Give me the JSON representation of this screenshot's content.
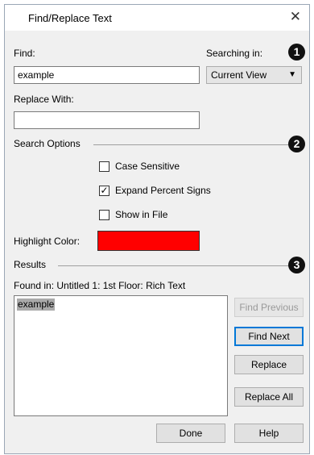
{
  "window": {
    "title": "Find/Replace Text",
    "close_glyph": "✕"
  },
  "find": {
    "label": "Find:",
    "value": "example"
  },
  "searching_in": {
    "label": "Searching in:",
    "value": "Current View",
    "arrow": "▼"
  },
  "replace": {
    "label": "Replace With:",
    "value": ""
  },
  "badges": {
    "one": "1",
    "two": "2",
    "three": "3"
  },
  "search_options": {
    "label": "Search Options",
    "case_sensitive": {
      "label": "Case Sensitive",
      "checked": false
    },
    "expand_percent": {
      "label": "Expand Percent Signs",
      "checked": true
    },
    "show_in_file": {
      "label": "Show in File",
      "checked": false
    }
  },
  "highlight": {
    "label": "Highlight Color:",
    "color": "#ff0000"
  },
  "results": {
    "label": "Results",
    "found_in": "Found in: Untitled 1: 1st Floor: Rich Text",
    "items": [
      "example"
    ]
  },
  "buttons": {
    "find_previous": "Find Previous",
    "find_next": "Find Next",
    "replace": "Replace",
    "replace_all": "Replace All",
    "done": "Done",
    "help": "Help"
  },
  "check_glyph": "✓"
}
